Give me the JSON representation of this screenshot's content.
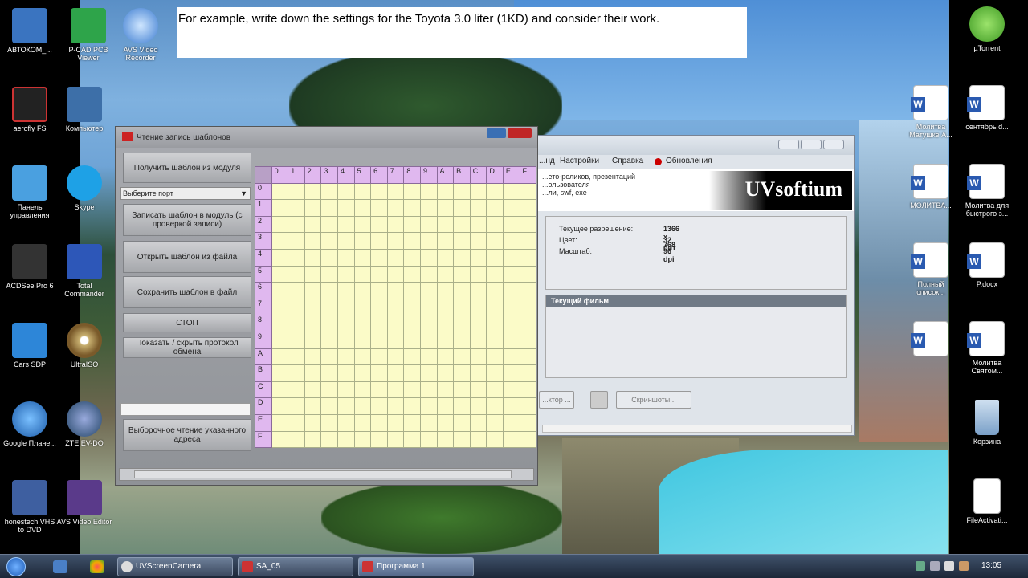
{
  "banner": {
    "text": "For example, write down the settings for the Toyota 3.0 liter (1KD) and consider their work."
  },
  "desktop_left": [
    {
      "label": "АВТОКОМ_...",
      "icon": "autokom-icon"
    },
    {
      "label": "P-CAD PCB Viewer",
      "icon": "pcad-icon"
    },
    {
      "label": "AVS Video Recorder",
      "icon": "avs-recorder-icon"
    },
    {
      "label": "aerofly FS",
      "icon": "aerofly-icon"
    },
    {
      "label": "Компьютер",
      "icon": "computer-icon"
    },
    {
      "label": "Панель управления",
      "icon": "control-panel-icon"
    },
    {
      "label": "Skype",
      "icon": "skype-icon"
    },
    {
      "label": "ACDSee Pro 6",
      "icon": "acdsee-icon"
    },
    {
      "label": "Total Commander",
      "icon": "total-commander-icon"
    },
    {
      "label": "Cars SDP",
      "icon": "car-icon"
    },
    {
      "label": "UltraISO",
      "icon": "disc-icon"
    },
    {
      "label": "Google Плане...",
      "icon": "google-earth-icon"
    },
    {
      "label": "ZTE EV-DO",
      "icon": "globe-icon"
    },
    {
      "label": "honestech VHS to DVD",
      "icon": "vhs-icon"
    },
    {
      "label": "AVS Video Editor",
      "icon": "film-icon"
    }
  ],
  "desktop_right": [
    {
      "label": "µTorrent",
      "icon": "utorrent-icon"
    },
    {
      "label": "Молитва Матушке А...",
      "icon": "word-doc-icon"
    },
    {
      "label": "сентябрь d...",
      "icon": "word-doc-icon"
    },
    {
      "label": "МОЛИТВА...",
      "icon": "word-doc-icon"
    },
    {
      "label": "Молитва для быстрого з...",
      "icon": "word-doc-icon"
    },
    {
      "label": "Полный список...",
      "icon": "word-doc-icon"
    },
    {
      "label": "P.docx",
      "icon": "word-doc-icon"
    },
    {
      "label": "Молитва Святом...",
      "icon": "word-doc-icon"
    },
    {
      "label": "Корзина",
      "icon": "recycle-bin-icon"
    },
    {
      "label": "FileActivati...",
      "icon": "file-icon"
    }
  ],
  "dialog": {
    "title": "Чтение запись шаблонов",
    "buttons": {
      "read": "Получить шаблон из модуля",
      "port_select": "Выберите порт",
      "write": "Записать шаблон в модуль (с проверкой записи)",
      "open": "Открыть шаблон из файла",
      "save": "Сохранить шаблон в файл",
      "stop": "СТОП",
      "log": "Показать / скрыть протокол обмена",
      "read_addr": "Выборочное чтение указанного адреса"
    },
    "hex": [
      "0",
      "1",
      "2",
      "3",
      "4",
      "5",
      "6",
      "7",
      "8",
      "9",
      "A",
      "B",
      "C",
      "D",
      "E",
      "F"
    ]
  },
  "uvwindow": {
    "menu": [
      "...нд",
      "Настройки",
      "Справка",
      "Обновления"
    ],
    "header_text": [
      "...ето-роликов, презентаций",
      "...ользователя",
      "...ли, swf, exe"
    ],
    "logo": "UVsoftium",
    "info": [
      {
        "k": "Текущее разрешение:",
        "v": "1366 x 768"
      },
      {
        "k": "Цвет:",
        "v": "32 бит"
      },
      {
        "k": "Масштаб:",
        "v": "96 dpi"
      }
    ],
    "current_film": "Текущий фильм",
    "btn_left": "...ктор ...",
    "btn_shots": "Скриншоты..."
  },
  "taskbar": {
    "items": [
      "UVScreenCamera",
      "SA_05",
      "Программа 1"
    ],
    "clock": "13:05"
  }
}
